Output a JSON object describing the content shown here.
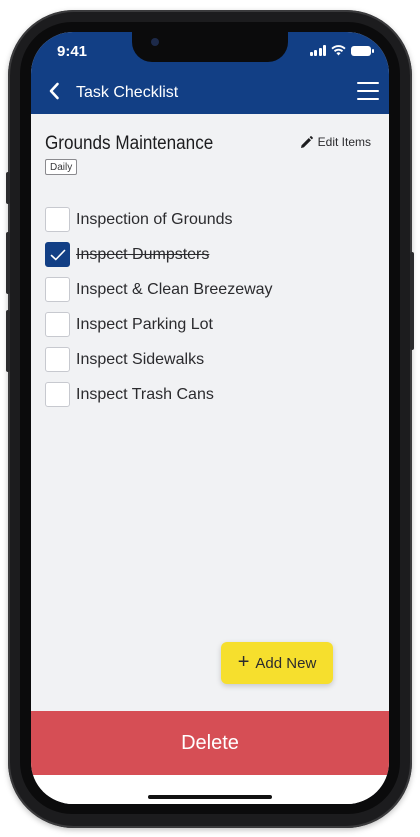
{
  "status_bar": {
    "time": "9:41"
  },
  "nav": {
    "title": "Task Checklist",
    "back_icon": "chevron-left-icon",
    "menu_icon": "hamburger-menu-icon"
  },
  "checklist": {
    "title": "Grounds Maintenance",
    "frequency_badge": "Daily",
    "edit_label": "Edit Items",
    "edit_icon": "pencil-icon",
    "items": [
      {
        "label": "Inspection of Grounds",
        "checked": false
      },
      {
        "label": "Inspect Dumpsters",
        "checked": true
      },
      {
        "label": "Inspect & Clean Breezeway",
        "checked": false
      },
      {
        "label": "Inspect Parking Lot",
        "checked": false
      },
      {
        "label": "Inspect Sidewalks",
        "checked": false
      },
      {
        "label": "Inspect Trash Cans",
        "checked": false
      }
    ]
  },
  "add_button": {
    "label": "Add New",
    "icon": "plus-icon"
  },
  "delete_button": {
    "label": "Delete"
  },
  "colors": {
    "nav_bar": "#123f85",
    "checked_box": "#123f85",
    "add_button": "#f6df2d",
    "delete_button": "#d64e55",
    "background": "#f1f2f4"
  }
}
